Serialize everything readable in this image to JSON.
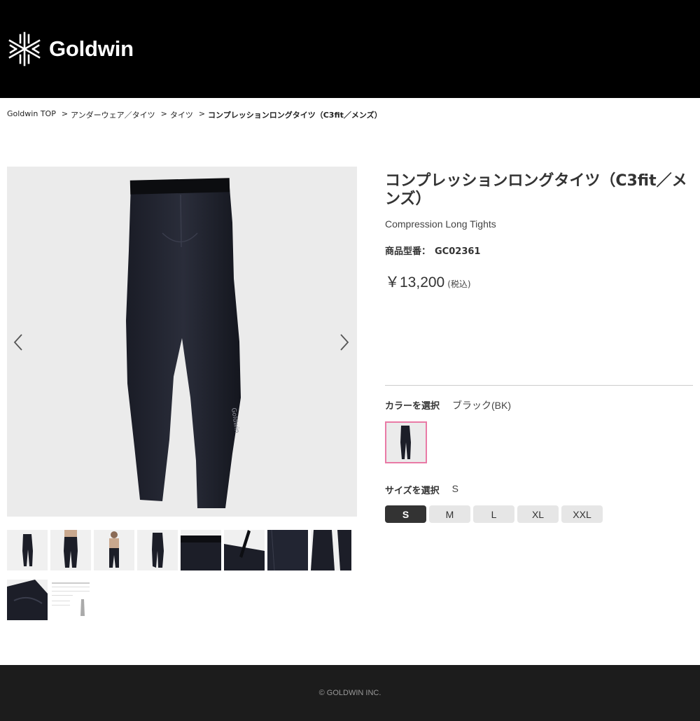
{
  "header": {
    "brand_name": "Goldwin",
    "logo_icon": "goldwin-snowflake-logo",
    "background": "#000000"
  },
  "breadcrumb": {
    "items": [
      "Goldwin TOP",
      "アンダーウェア／タイツ",
      "タイツ",
      "コンプレッションロングタイツ（C3fit／メンズ）"
    ],
    "separator": ">"
  },
  "gallery": {
    "prev_icon": "chevron-left-icon",
    "next_icon": "chevron-right-icon",
    "thumbnails": [
      "front-full-view",
      "model-front",
      "model-full-body",
      "side-view",
      "waistband-detail",
      "waistband-open-detail",
      "fabric-detail",
      "logo-detail",
      "fabric-stretch-detail",
      "size-chart"
    ]
  },
  "product": {
    "title": "コンプレッションロングタイツ（C3fit／メンズ）",
    "subtitle": "Compression Long Tights",
    "sku_label": "商品型番：",
    "sku_value": "GC02361",
    "price": "￥13,200",
    "tax_note": "(税込)"
  },
  "color_selector": {
    "label": "カラーを選択",
    "selected": "ブラック(BK)",
    "selected_border_color": "#e97aa6"
  },
  "size_selector": {
    "label": "サイズを選択",
    "selected": "S",
    "options": [
      "S",
      "M",
      "L",
      "XL",
      "XXL"
    ]
  },
  "footer": {
    "copyright": "© GOLDWIN INC."
  }
}
